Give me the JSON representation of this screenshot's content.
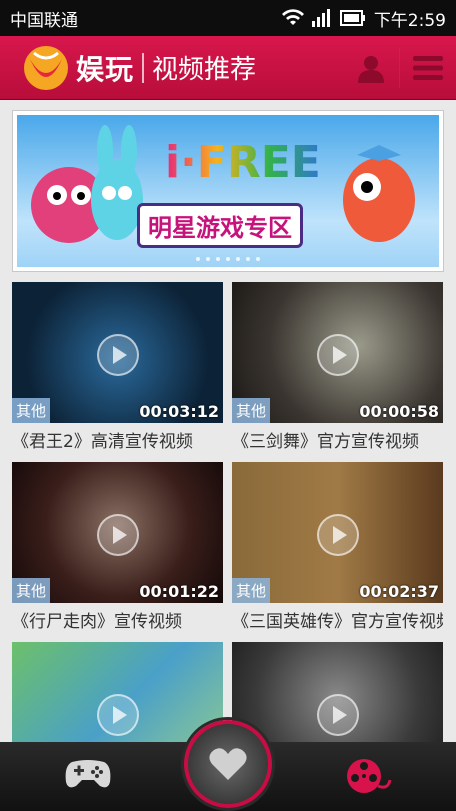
{
  "status": {
    "carrier": "中国联通",
    "time": "下午2:59"
  },
  "appbar": {
    "brand": "娱玩",
    "title": "视频推荐",
    "accent": "#c8103f"
  },
  "banner": {
    "title": "i·FREE",
    "subtitle": "明星游戏专区"
  },
  "videos": [
    {
      "tag": "其他",
      "duration": "00:03:12",
      "caption": "《君王2》高清宣传视频"
    },
    {
      "tag": "其他",
      "duration": "00:00:58",
      "caption": "《三剑舞》官方宣传视频"
    },
    {
      "tag": "其他",
      "duration": "00:01:22",
      "caption": "《行尸走肉》宣传视频"
    },
    {
      "tag": "其他",
      "duration": "00:02:37",
      "caption": "《三国英雄传》官方宣传视频"
    },
    {
      "tag": "",
      "duration": "",
      "caption": ""
    },
    {
      "tag": "",
      "duration": "",
      "caption": ""
    }
  ],
  "bottom_nav": {
    "left_icon": "gamepad-icon",
    "center_icon": "heart-icon",
    "right_icon": "film-reel-icon"
  }
}
